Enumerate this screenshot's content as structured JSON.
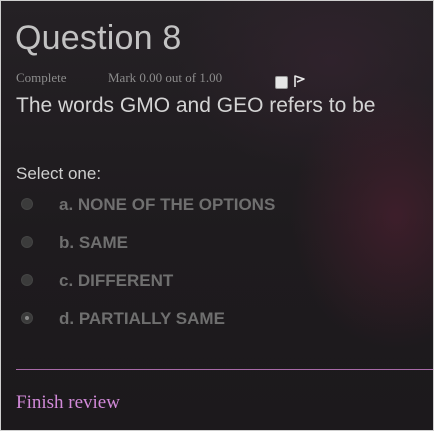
{
  "question": {
    "title": "Question 8",
    "status": "Complete",
    "mark": "Mark 0.00 out of 1.00",
    "text": "The words GMO and GEO refers to be"
  },
  "answer_block": {
    "prompt": "Select one:",
    "options": [
      {
        "label": "a. NONE OF THE OPTIONS",
        "selected": false
      },
      {
        "label": "b. SAME",
        "selected": false
      },
      {
        "label": "c. DIFFERENT",
        "selected": false
      },
      {
        "label": "d. PARTIALLY SAME",
        "selected": true
      }
    ]
  },
  "icons": {
    "flag": "flag-icon"
  },
  "footer": {
    "finish_review": "Finish review"
  },
  "colors": {
    "link": "#d189d8",
    "divider": "#a86aa8"
  }
}
